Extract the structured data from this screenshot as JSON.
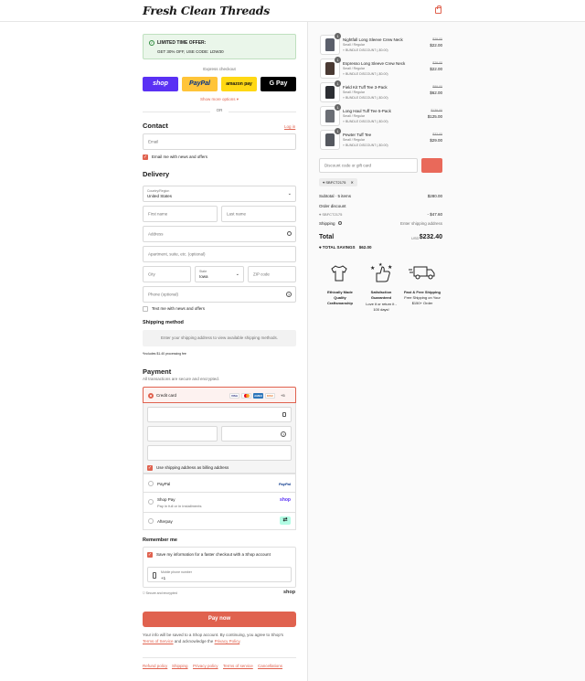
{
  "header": {
    "logo": "Fresh Clean Threads",
    "bag_icon": "shopping-bag-icon",
    "accent": "#e0624f"
  },
  "offer": {
    "title": "LIMITED TIME OFFER:",
    "text": "GET 30% OFF, USE CODE: LDW30",
    "check_glyph": "✓",
    "check_icon": "check-circle-icon"
  },
  "express": {
    "label": "Express checkout",
    "shop": "shop",
    "paypal": "PayPal",
    "amazon": "amazon pay",
    "gpay": "G Pay",
    "more": "Show more options ▾",
    "or": "OR"
  },
  "contact": {
    "title": "Contact",
    "login": "Log in",
    "email_placeholder": "Email",
    "newsletter": "Email me with news and offers"
  },
  "delivery": {
    "title": "Delivery",
    "country_label": "Country/Region",
    "country_value": "United States",
    "first_name": "First name",
    "last_name": "Last name",
    "address": "Address",
    "apartment": "Apartment, suite, etc. (optional)",
    "city": "City",
    "state_label": "State",
    "state_value": "Iowa",
    "zip": "ZIP code",
    "phone": "Phone (optional)",
    "text_me": "Text me with news and offers"
  },
  "shipping": {
    "title": "Shipping method",
    "note": "Enter your shipping address to view available shipping methods.",
    "fee_note": "*Includes $1.40 processing fee"
  },
  "payment": {
    "title": "Payment",
    "subtitle": "All transactions are secure and encrypted.",
    "credit_card": "Credit card",
    "cards": [
      "VISA",
      "MC",
      "AMEX",
      "DISC"
    ],
    "more_cards": "+5",
    "billing": "Use shipping address as billing address",
    "paypal": "PayPal",
    "paypal_logo": "PayPal",
    "shop_pay": "Shop Pay",
    "shop_pay_sub": "Pay in full or in installments",
    "shop_logo": "shop",
    "afterpay": "Afterpay",
    "afterpay_logo": "⇄"
  },
  "remember": {
    "title": "Remember me",
    "save": "Save my information for a faster checkout with a Shop account",
    "phone_label": "Mobile phone number",
    "phone_value": "+1",
    "secure": "Secure and encrypted",
    "shop": "shop"
  },
  "pay_now": "Pay now",
  "legal": {
    "line1": "Your info will be saved to a Shop account. By continuing, you agree to Shop's",
    "terms": "Terms of Service",
    "and": " and acknowledge the ",
    "privacy": "Privacy Policy",
    "end": "."
  },
  "footer_links": [
    "Refund policy",
    "Shipping",
    "Privacy policy",
    "Terms of service",
    "Cancellations"
  ],
  "cart": {
    "items": [
      {
        "qty": "1",
        "name": "Nightfall Long Sleeve Crew Neck",
        "variant": "Small / Regular",
        "discount": "BUNDLE DISCOUNT (-$0.00)",
        "was": "$29.00",
        "price": "$22.00"
      },
      {
        "qty": "1",
        "name": "Espresso Long Sleeve Crew Neck",
        "variant": "Small / Regular",
        "discount": "BUNDLE DISCOUNT (-$0.00)",
        "was": "$29.00",
        "price": "$22.00"
      },
      {
        "qty": "1",
        "name": "Field Kit Tuff Tee 3-Pack",
        "variant": "Small / Regular",
        "discount": "BUNDLE DISCOUNT (-$0.00)",
        "was": "$89.00",
        "price": "$62.00"
      },
      {
        "qty": "1",
        "name": "Long Haul Tuff Tee 5-Pack",
        "variant": "Small / Regular",
        "discount": "BUNDLE DISCOUNT (-$0.00)",
        "was": "$139.00",
        "price": "$125.00"
      },
      {
        "qty": "1",
        "name": "Pewter Tuff Tee",
        "variant": "Small / Regular",
        "discount": "BUNDLE DISCOUNT (-$0.00)",
        "was": "$32.00",
        "price": "$29.00"
      }
    ],
    "discount_placeholder": "Discount code or gift card",
    "applied_code": "SBFCT2175",
    "subtotal_label": "Subtotal · 5 items",
    "subtotal": "$280.00",
    "order_discount_label": "Order discount",
    "order_code": "SBFCT2175",
    "order_discount": "- $47.60",
    "shipping_label": "Shipping",
    "shipping_value": "Enter shipping address",
    "total_label": "Total",
    "currency": "USD",
    "total": "$232.40",
    "savings_label": "TOTAL SAVINGS",
    "savings": "$62.00"
  },
  "features": [
    {
      "icon": "shirt-icon",
      "title": "Ethically Made Quality Craftsmanship",
      "sub": ""
    },
    {
      "icon": "stars-thumbs-up-icon",
      "title": "Satisfaction Guaranteed",
      "sub": "Love it or return it - 100 days!"
    },
    {
      "icon": "delivery-truck-icon",
      "title": "Fast & Free Shipping",
      "sub": "Free Shipping on Your $150+ Order"
    }
  ]
}
